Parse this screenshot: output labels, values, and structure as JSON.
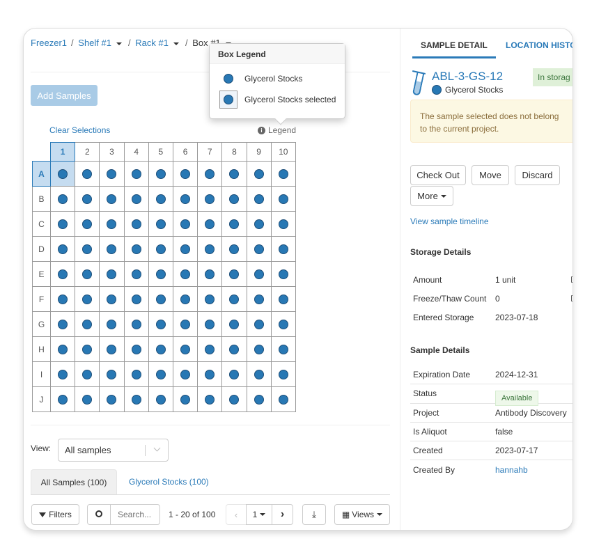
{
  "breadcrumb": {
    "freezer": "Freezer1",
    "shelf": "Shelf #1",
    "rack": "Rack #1",
    "box": "Box #1",
    "sep": "/"
  },
  "add_samples": "Add Samples",
  "clear_selections": "Clear Selections",
  "legend_link": "Legend",
  "legend_popover": {
    "title": "Box Legend",
    "items": [
      "Glycerol Stocks",
      "Glycerol Stocks selected"
    ]
  },
  "grid": {
    "columns": [
      "1",
      "2",
      "3",
      "4",
      "5",
      "6",
      "7",
      "8",
      "9",
      "10"
    ],
    "rows": [
      "A",
      "B",
      "C",
      "D",
      "E",
      "F",
      "G",
      "H",
      "I",
      "J"
    ],
    "selected_row": "A",
    "selected_col": "1",
    "dot_color": "#2878b4"
  },
  "view": {
    "label": "View:",
    "value": "All samples"
  },
  "tabs": [
    {
      "label": "All Samples (100)"
    },
    {
      "label": "Glycerol Stocks (100)"
    }
  ],
  "toolbar": {
    "filters": "Filters",
    "search_placeholder": "Search...",
    "range": "1 - 20 of 100",
    "page": "1",
    "views": "Views"
  },
  "detail": {
    "tabs": [
      "SAMPLE DETAIL",
      "LOCATION HISTO"
    ],
    "sample_id": "ABL-3-GS-12",
    "sample_type": "Glycerol Stocks",
    "status_badge": "In storag",
    "warning": "The sample selected does not belong to the current project.",
    "actions": {
      "checkout": "Check Out",
      "move": "Move",
      "discard": "Discard",
      "more": "More"
    },
    "timeline_link": "View sample timeline",
    "storage_title": "Storage Details",
    "storage": [
      {
        "k": "Amount",
        "v": "1 unit"
      },
      {
        "k": "Freeze/Thaw Count",
        "v": "0"
      },
      {
        "k": "Entered Storage",
        "v": "2023-07-18"
      }
    ],
    "sample_title": "Sample Details",
    "sample": {
      "expiration_k": "Expiration Date",
      "expiration_v": "2024-12-31",
      "status_k": "Status",
      "status_v": "Available",
      "project_k": "Project",
      "project_v": "Antibody Discovery",
      "aliquot_k": "Is Aliquot",
      "aliquot_v": "false",
      "created_k": "Created",
      "created_v": "2023-07-17",
      "createdby_k": "Created By",
      "createdby_v": "hannahb"
    }
  }
}
